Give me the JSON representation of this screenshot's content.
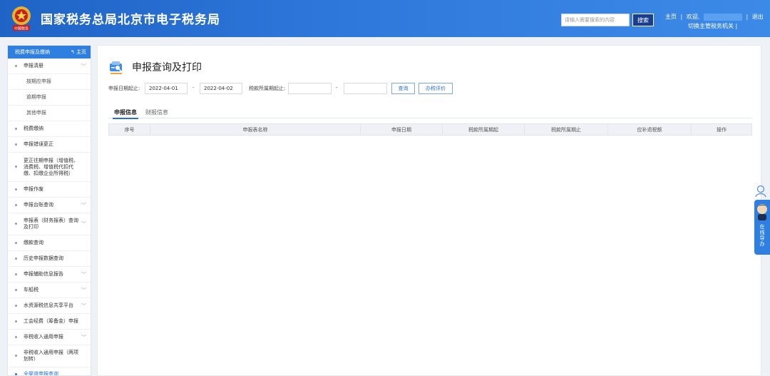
{
  "header": {
    "site_title": "国家税务总局北京市电子税务局",
    "emblem_text": "中国税务",
    "search_placeholder": "请输入需要搜索的内容",
    "search_button": "搜索",
    "home_link": "主页",
    "welcome": "欢迎,",
    "logout": "退出",
    "switch_org": "切换主管税务机关",
    "separator": "|"
  },
  "sidebar": {
    "title": "税费申报及缴纳",
    "home": "主页",
    "items": [
      {
        "label": "申报清册",
        "level": 1,
        "chevron": true
      },
      {
        "label": "按期应申报",
        "level": 2
      },
      {
        "label": "逾期申报",
        "level": 2
      },
      {
        "label": "其他申报",
        "level": 2
      },
      {
        "label": "税费缴纳",
        "level": 1
      },
      {
        "label": "申报错误更正",
        "level": 1
      },
      {
        "label": "更正往期申报（增值税、消费税、增值税代扣代缴、扣缴企业所得税）",
        "level": 1
      },
      {
        "label": "申报作废",
        "level": 1
      },
      {
        "label": "申报台账查询",
        "level": 1,
        "chevron": true
      },
      {
        "label": "申报表（财务报表）查询及打印",
        "level": 1,
        "chevron": true
      },
      {
        "label": "缴款查询",
        "level": 1
      },
      {
        "label": "历史申报数据查询",
        "level": 1
      },
      {
        "label": "申报辅助信息报告",
        "level": 1,
        "chevron": true
      },
      {
        "label": "车船税",
        "level": 1,
        "chevron": true
      },
      {
        "label": "水资源税信息共享平台",
        "level": 1,
        "chevron": true
      },
      {
        "label": "工会经费（筹备金）申报",
        "level": 1
      },
      {
        "label": "非税收入通用申报",
        "level": 1,
        "chevron": true
      },
      {
        "label": "非税收入通用申报（两项划转）",
        "level": 1
      },
      {
        "label": "全渠道申报查询",
        "level": 1,
        "active": true
      }
    ]
  },
  "main": {
    "title": "申报查询及打印",
    "filters": {
      "date_label": "申报日期起止:",
      "date_from": "2022-04-01",
      "dash": "-",
      "date_to": "2022-04-02",
      "period_label": "税款所属期起止:",
      "period_from": "",
      "period_to": "",
      "query_button": "查询",
      "evaluate_button": "办税评价"
    },
    "tabs": [
      "申报信息",
      "财报信息"
    ],
    "table_headers": [
      "序号",
      "申报表名称",
      "申报日期",
      "税款所属期起",
      "税款所属期止",
      "应补退税额",
      "操作"
    ]
  },
  "float_widget": {
    "label_chars": [
      "在",
      "线",
      "导",
      "办"
    ]
  },
  "colors": {
    "header_blue": "#2f78db",
    "accent_blue": "#2b6fd6",
    "sidebar_head": "#2f7fe0"
  }
}
